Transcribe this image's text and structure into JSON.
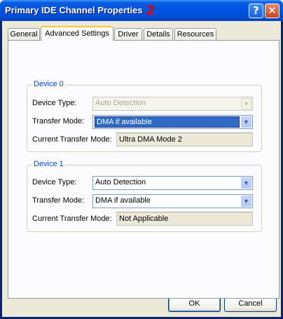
{
  "window": {
    "title": "Primary IDE Channel Properties",
    "annotation": "2",
    "help_glyph": "?",
    "close_glyph": "✕"
  },
  "tabs": [
    {
      "label": "General",
      "active": false
    },
    {
      "label": "Advanced Settings",
      "active": true
    },
    {
      "label": "Driver",
      "active": false
    },
    {
      "label": "Details",
      "active": false
    },
    {
      "label": "Resources",
      "active": false
    }
  ],
  "device0": {
    "legend": "Device 0",
    "device_type_label": "Device Type:",
    "device_type_value": "Auto Detection",
    "device_type_disabled": true,
    "transfer_mode_label": "Transfer Mode:",
    "transfer_mode_value": "DMA if available",
    "current_mode_label": "Current Transfer Mode:",
    "current_mode_value": "Ultra DMA Mode 2"
  },
  "device1": {
    "legend": "Device 1",
    "device_type_label": "Device Type:",
    "device_type_value": "Auto Detection",
    "transfer_mode_label": "Transfer Mode:",
    "transfer_mode_value": "DMA if available",
    "current_mode_label": "Current Transfer Mode:",
    "current_mode_value": "Not Applicable"
  },
  "buttons": {
    "ok": "OK",
    "cancel": "Cancel"
  },
  "icons": {
    "dropdown": "chevron-down-icon",
    "help": "help-icon",
    "close": "close-icon"
  },
  "colors": {
    "titlebar": "#0054e3",
    "legend": "#0046d5",
    "selection": "#316ac5",
    "annotation": "#e00000"
  }
}
